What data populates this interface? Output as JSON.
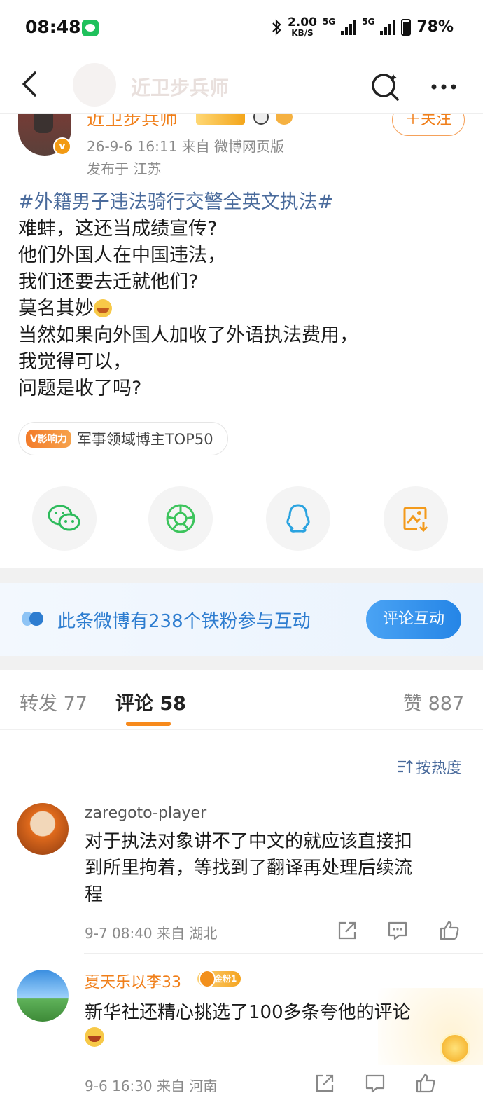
{
  "status_bar": {
    "time": "08:48",
    "net_speed_value": "2.00",
    "net_speed_unit": "KB/S",
    "network_1": "5G",
    "network_2": "5G",
    "battery": "78%"
  },
  "nav": {
    "title": "近卫步兵师"
  },
  "post": {
    "author": "近卫步兵师",
    "follow_label": "＋关注",
    "meta": "26-9-6 16:11  来自 微博网页版",
    "location": "发布于 江苏",
    "hashtag": "#外籍男子违法骑行交警全英文执法#",
    "lines": [
      "难蚌，这还当成绩宣传?",
      "他们外国人在中国违法，",
      "我们还要去迁就他们?",
      "莫名其妙",
      "当然如果向外国人加收了外语执法费用，",
      "我觉得可以，",
      "问题是收了吗?"
    ],
    "influence_logo": "V影响力",
    "influence_text": "军事领域博主TOP50"
  },
  "share": {
    "icons": [
      "wechat-icon",
      "moments-icon",
      "qq-icon",
      "save-image-icon"
    ],
    "colors": {
      "wechat": "#2dbb5b",
      "moments": "#3cc45c",
      "qq": "#2aa3e0",
      "save": "#f39a1b"
    }
  },
  "fans_banner": {
    "text": "此条微博有238个铁粉参与互动",
    "button": "评论互动"
  },
  "tabs": {
    "repost": "转发 77",
    "comments": "评论 58",
    "likes": "赞 887"
  },
  "sort_label": "按热度",
  "comments": [
    {
      "user": "zaregoto-player",
      "text_lines": [
        "对于执法对象讲不了中文的就应该直接扣",
        "到所里拘着，等找到了翻译再处理后续流",
        "程"
      ],
      "meta": "9-7 08:40  来自 湖北",
      "user_color": "#555555"
    },
    {
      "user": "夏天乐以李33",
      "badge": "金粉1",
      "text_lines": [
        "新华社还精心挑选了100多条夸他的评论"
      ],
      "meta": "9-6 16:30  来自 河南",
      "user_color": "#f07f1a"
    }
  ],
  "accent_color": "#f78a1c",
  "link_color": "#4a6b9c"
}
